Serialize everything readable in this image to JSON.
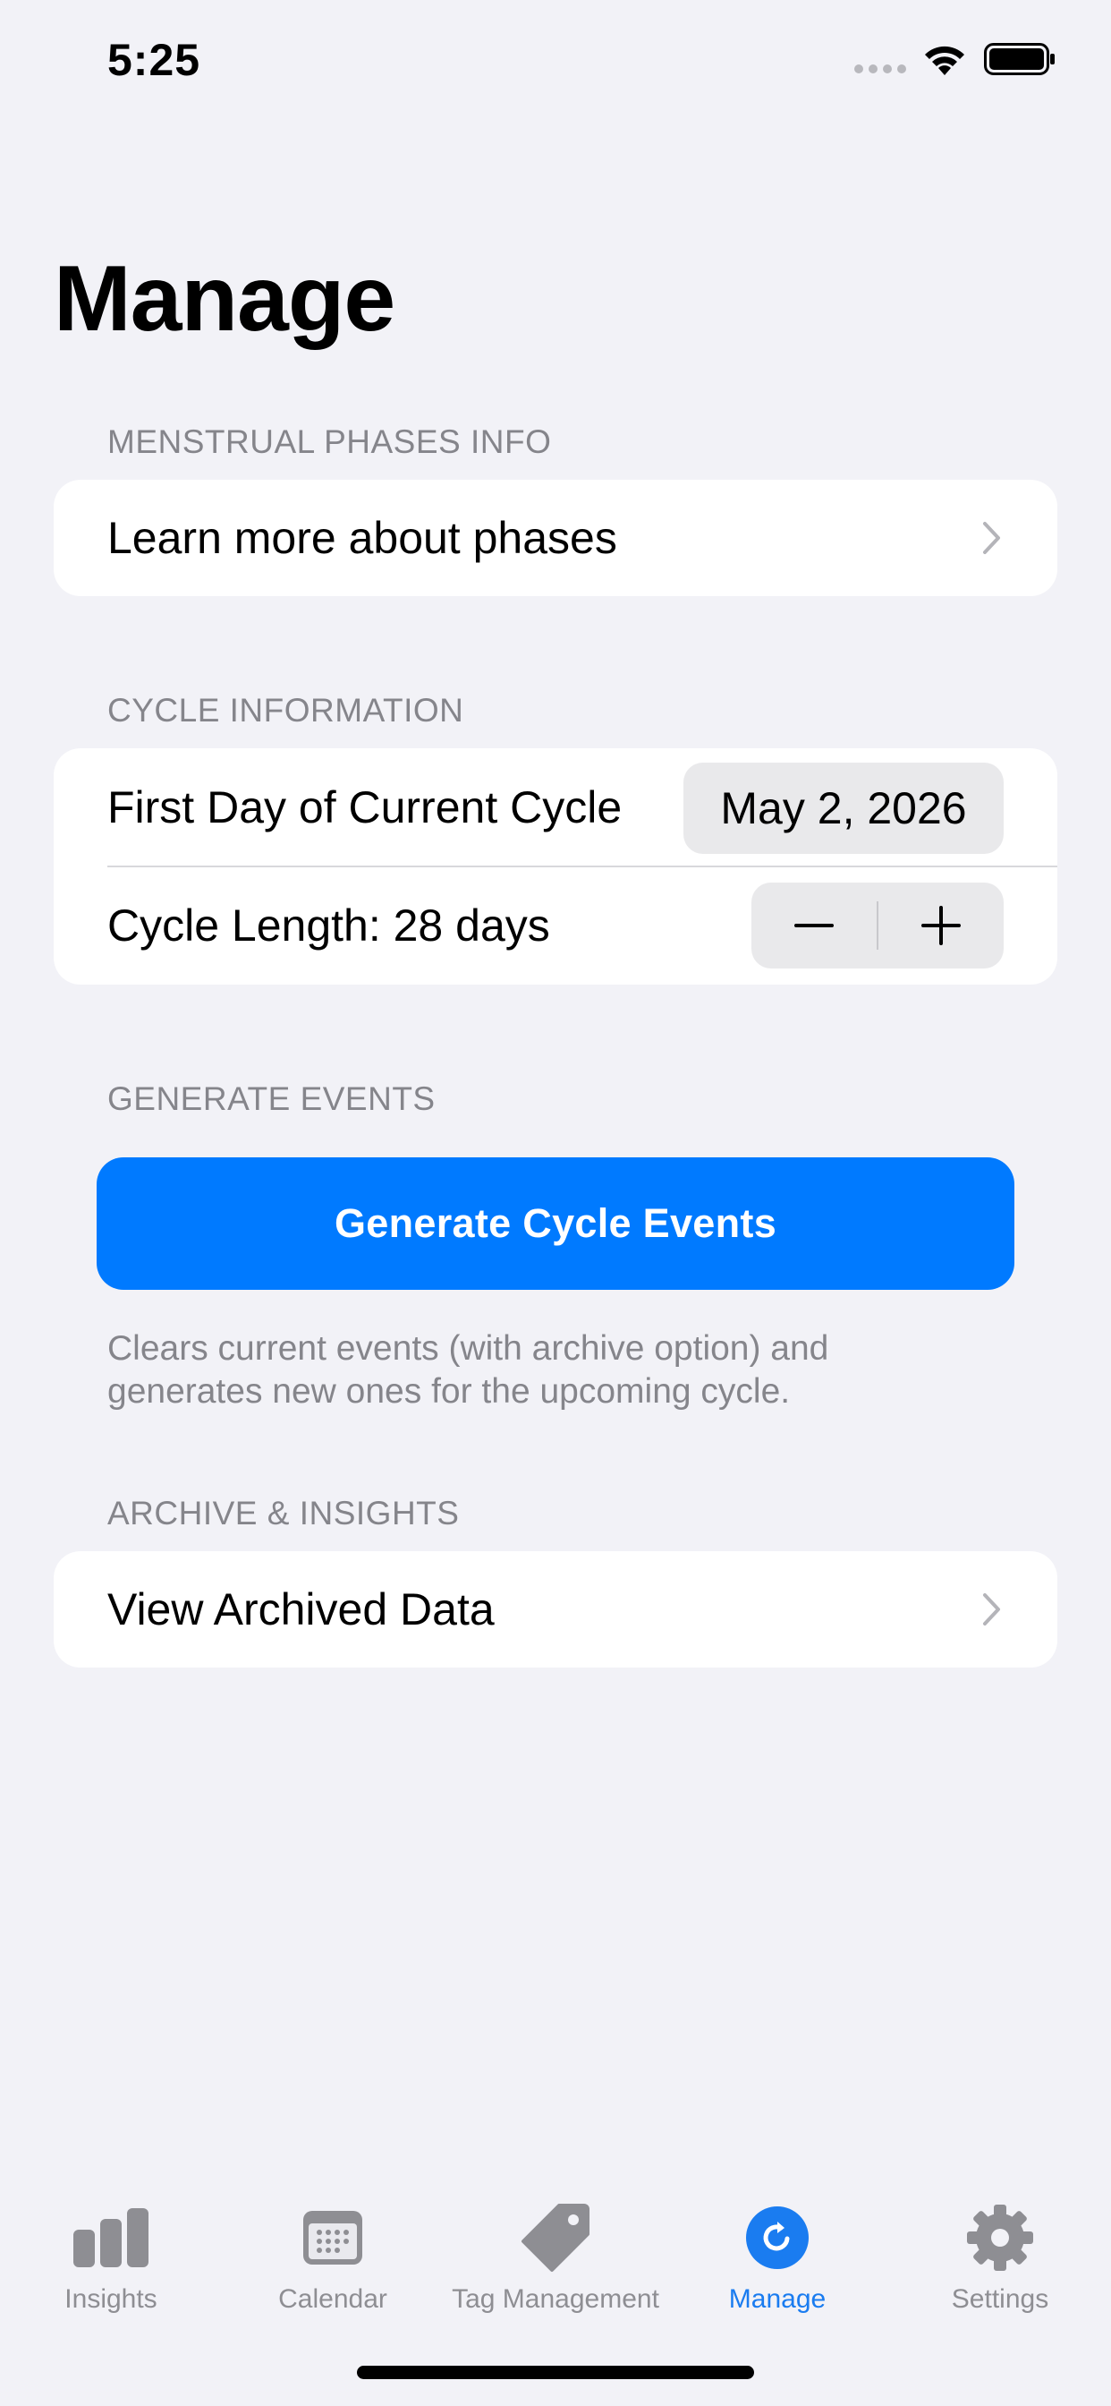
{
  "status_bar": {
    "time": "5:25"
  },
  "page": {
    "title": "Manage"
  },
  "sections": {
    "phases": {
      "header": "MENSTRUAL PHASES INFO",
      "row_label": "Learn more about phases"
    },
    "cycle": {
      "header": "CYCLE INFORMATION",
      "first_day_label": "First Day of Current Cycle",
      "first_day_value": "May 2, 2026",
      "length_label": "Cycle Length: 28 days"
    },
    "generate": {
      "header": "GENERATE EVENTS",
      "button_label": "Generate Cycle Events",
      "footnote": "Clears current events (with archive option) and generates new ones for the upcoming cycle."
    },
    "archive": {
      "header": "ARCHIVE & INSIGHTS",
      "row_label": "View Archived Data"
    }
  },
  "tab_bar": {
    "tabs": [
      {
        "label": "Insights",
        "icon": "bar-chart-icon"
      },
      {
        "label": "Calendar",
        "icon": "calendar-icon"
      },
      {
        "label": "Tag Management",
        "icon": "tag-icon"
      },
      {
        "label": "Manage",
        "icon": "refresh-circle-icon",
        "active": true
      },
      {
        "label": "Settings",
        "icon": "gear-icon"
      }
    ]
  },
  "colors": {
    "accent": "#007aff",
    "background": "#f2f2f7",
    "secondary_text": "#85858b",
    "tab_inactive": "#8e8e93"
  }
}
